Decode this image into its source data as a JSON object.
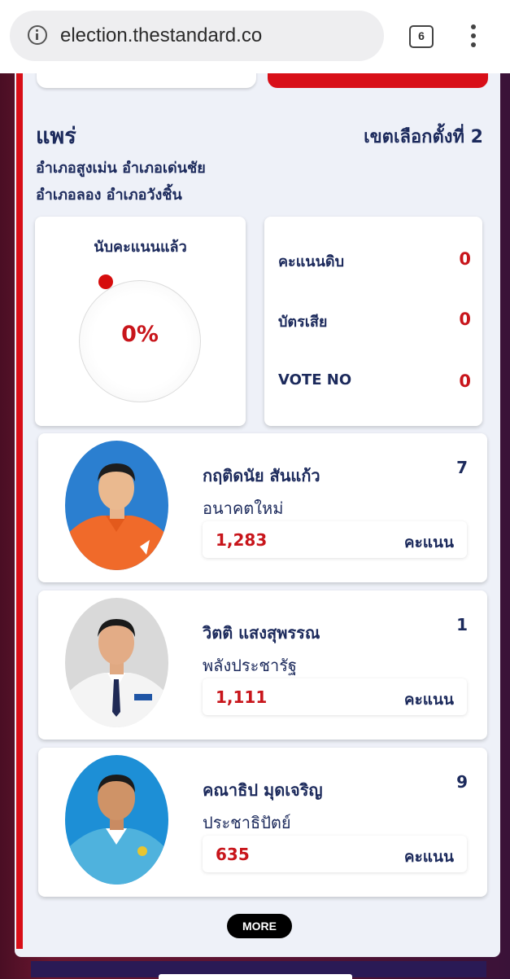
{
  "browser": {
    "url": "election.thestandard.co",
    "tab_count": "6"
  },
  "header": {
    "province": "แพร่",
    "district": "เขตเลือกตั้งที่ 2",
    "areas": [
      "อำเภอสูงเม่น อำเภอเด่นชัย",
      "อำเภอลอง อำเภอวังชิ้น"
    ]
  },
  "count": {
    "title": "นับคะแนนแล้ว",
    "percent": "0%"
  },
  "stats": [
    {
      "label": "คะแนนดิบ",
      "value": "0"
    },
    {
      "label": "บัตรเสีย",
      "value": "0"
    },
    {
      "label": "VOTE NO",
      "value": "0"
    }
  ],
  "candidates": [
    {
      "name": "กฤติดนัย สันแก้ว",
      "number": "7",
      "party": "อนาคตใหม่",
      "score": "1,283",
      "unit": "คะแนน"
    },
    {
      "name": "วิตติ แสงสุพรรณ",
      "number": "1",
      "party": "พลังประชารัฐ",
      "score": "1,111",
      "unit": "คะแนน"
    },
    {
      "name": "คณาธิป มุดเจริญ",
      "number": "9",
      "party": "ประชาธิปัตย์",
      "score": "635",
      "unit": "คะแนน"
    }
  ],
  "more_label": "MORE",
  "colors": {
    "accent_red": "#c8151b",
    "navy": "#1c2a5c",
    "panel_bg": "#eef1f8"
  }
}
